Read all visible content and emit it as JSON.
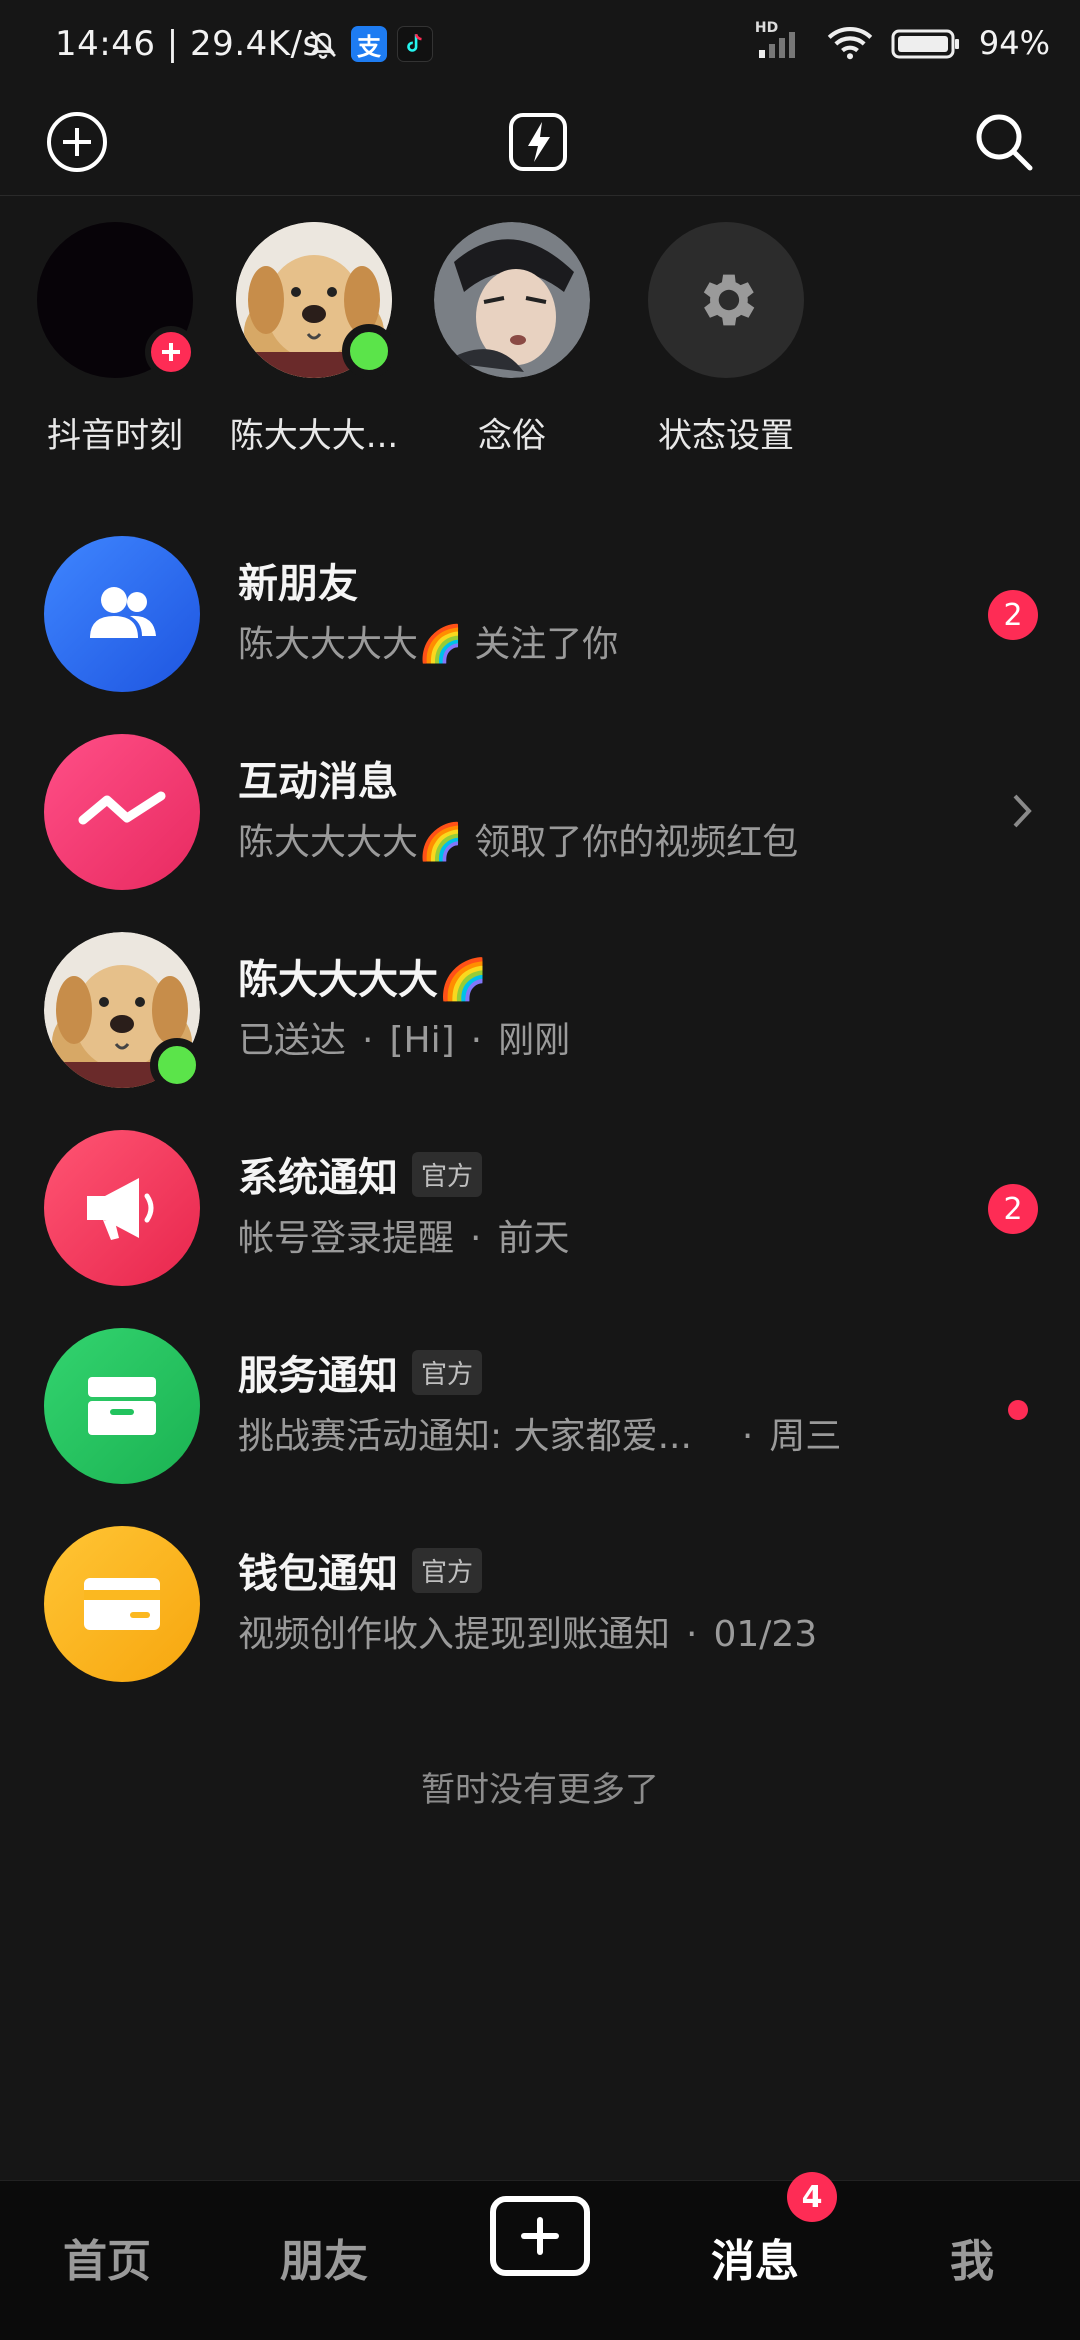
{
  "status_bar": {
    "time": "14:46 | 29.4K/s",
    "battery_pct": "94%",
    "hd_label": "HD",
    "alipay_label": "支",
    "accent_colors": {
      "alipay": "#1e7cf2",
      "douyin": "#fe2c55"
    }
  },
  "top_bar": {
    "left_icon": "add-circle-icon",
    "center_icon": "flash-icon",
    "right_icon": "search-icon"
  },
  "stories": [
    {
      "label": "抖音时刻",
      "type": "self"
    },
    {
      "label": "陈大大大...",
      "type": "friend_online"
    },
    {
      "label": "念俗",
      "type": "friend"
    },
    {
      "label": "状态设置",
      "type": "settings"
    }
  ],
  "messages": [
    {
      "title": "新朋友",
      "subtitle": "陈大大大大🌈 关注了你",
      "badge": "2",
      "icon": "friends-icon",
      "color": "#2f6df0"
    },
    {
      "title": "互动消息",
      "subtitle": "陈大大大大🌈 领取了你的视频红包",
      "icon": "interaction-icon",
      "color": "#f0346b"
    },
    {
      "title": "陈大大大大🌈",
      "subtitle_parts": [
        "已送达",
        "[Hi]",
        "刚刚"
      ],
      "icon": "dog-avatar"
    },
    {
      "title": "系统通知",
      "tag": "官方",
      "subtitle_parts": [
        "帐号登录提醒",
        "前天"
      ],
      "badge": "2",
      "icon": "megaphone-icon",
      "color": "#f03a5f"
    },
    {
      "title": "服务通知",
      "tag": "官方",
      "subtitle_parts": [
        "挑战赛活动通知: 大家都爱...",
        "周三"
      ],
      "icon": "inbox-icon",
      "color": "#22c35e"
    },
    {
      "title": "钱包通知",
      "tag": "官方",
      "subtitle_parts": [
        "视频创作收入提现到账通知",
        "01/23"
      ],
      "icon": "wallet-icon",
      "color": "#fbb820"
    }
  ],
  "separator": "·",
  "footer_text": "暂时没有更多了",
  "bottom_nav": {
    "home": "首页",
    "friends": "朋友",
    "messages": "消息",
    "messages_badge": "4",
    "me": "我"
  }
}
